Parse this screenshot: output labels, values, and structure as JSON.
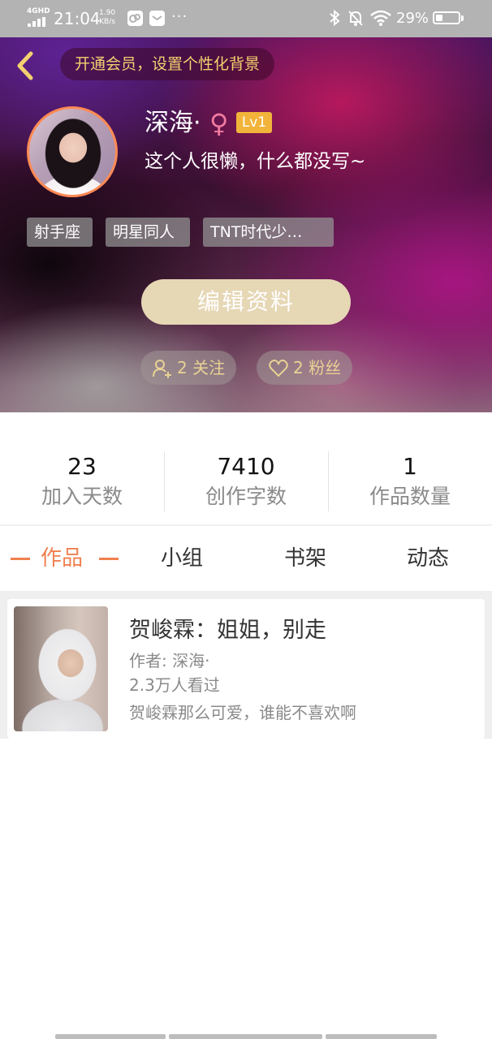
{
  "status_bar": {
    "network": "4GHD",
    "time": "21:04",
    "speed_value": "1.90",
    "speed_unit": "KB/s",
    "dots": "···",
    "battery_percent": "29%",
    "battery_level": 0.29,
    "icons": [
      "signal-icon",
      "app-icon",
      "mail-icon",
      "bluetooth-icon",
      "bell-muted-icon",
      "wifi-icon",
      "battery-icon"
    ]
  },
  "header": {
    "back_icon": "chevron-left-icon",
    "vip_banner": "开通会员，设置个性化背景",
    "username": "深海·",
    "gender_symbol": "♀",
    "level": "Lv1",
    "bio": "这个人很懒，什么都没写~",
    "tags": [
      "射手座",
      "明星同人",
      "TNT时代少…"
    ],
    "edit_button": "编辑资料",
    "follow": "2 关注",
    "fans": "2 粉丝",
    "colors": {
      "accent_gold": "#f3d070",
      "level_badge": "#f2b33a",
      "edit_button": "#e6d7b5",
      "avatar_border": "#ff8a55"
    }
  },
  "stats": [
    {
      "value": "23",
      "label": "加入天数"
    },
    {
      "value": "7410",
      "label": "创作字数"
    },
    {
      "value": "1",
      "label": "作品数量"
    }
  ],
  "tabs": [
    {
      "label": "作品",
      "active": true
    },
    {
      "label": "小组",
      "active": false
    },
    {
      "label": "书架",
      "active": false
    },
    {
      "label": "动态",
      "active": false
    }
  ],
  "active_tab_color": "#f08050",
  "works": [
    {
      "title": "贺峻霖：姐姐，别走",
      "author": "作者: 深海·",
      "views": "2.3万人看过",
      "description": "贺峻霖那么可爱，谁能不喜欢啊"
    }
  ]
}
